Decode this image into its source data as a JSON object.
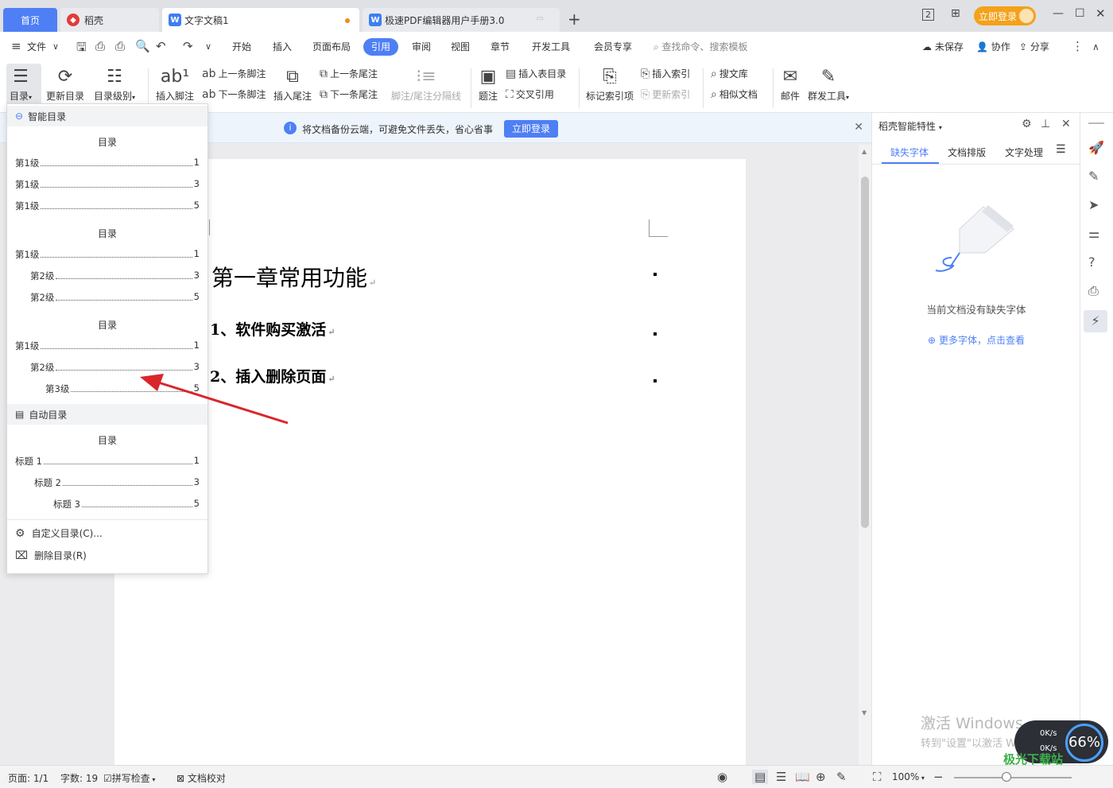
{
  "tabs": {
    "home": "首页",
    "daoke": "稻壳",
    "doc1": "文字文稿1",
    "pdf": "极速PDF编辑器用户手册3.0"
  },
  "top_right": {
    "login": "立即登录",
    "badge": "2"
  },
  "menubar": {
    "file": "文件",
    "items": [
      "开始",
      "插入",
      "页面布局",
      "引用",
      "审阅",
      "视图",
      "章节",
      "开发工具",
      "会员专享"
    ],
    "search": "查找命令、搜索模板",
    "unsaved": "未保存",
    "collab": "协作",
    "share": "分享"
  },
  "ribbon": {
    "mulu": "目录",
    "update_toc": "更新目录",
    "toc_level": "目录级别",
    "insert_footnote": "插入脚注",
    "prev_footnote": "上一条脚注",
    "next_footnote": "下一条脚注",
    "insert_endnote": "插入尾注",
    "prev_endnote": "上一条尾注",
    "next_endnote": "下一条尾注",
    "separator": "脚注/尾注分隔线",
    "caption": "题注",
    "insert_table_toc": "插入表目录",
    "cross_ref": "交叉引用",
    "mark_index": "标记索引项",
    "insert_index": "插入索引",
    "update_index": "更新索引",
    "search_lib": "搜文库",
    "similar_doc": "相似文档",
    "mail": "邮件",
    "mass_tools": "群发工具"
  },
  "notice": {
    "text": "将文档备份云端，可避免文件丢失，省心省事",
    "button": "立即登录"
  },
  "document": {
    "h1": "第一章常用功能",
    "h2a": "1、软件购买激活",
    "h2b": "2、插入删除页面"
  },
  "dropdown": {
    "smart_title": "智能目录",
    "toc_heading": "目录",
    "g1": [
      {
        "label": "第1级",
        "page": "1"
      },
      {
        "label": "第1级",
        "page": "3"
      },
      {
        "label": "第1级",
        "page": "5"
      }
    ],
    "g2": [
      {
        "label": "第1级",
        "page": "1"
      },
      {
        "label": "第2级",
        "page": "3"
      },
      {
        "label": "第2级",
        "page": "5"
      }
    ],
    "g3": [
      {
        "label": "第1级",
        "page": "1"
      },
      {
        "label": "第2级",
        "page": "3"
      },
      {
        "label": "第3级",
        "page": "5"
      }
    ],
    "auto_title": "自动目录",
    "g4": [
      {
        "label": "标题 1",
        "page": "1"
      },
      {
        "label": "标题 2",
        "page": "3"
      },
      {
        "label": "标题 3",
        "page": "5"
      }
    ],
    "custom": "自定义目录(C)...",
    "delete": "删除目录(R)"
  },
  "panel": {
    "title": "稻壳智能特性",
    "tabs": [
      "缺失字体",
      "文档排版",
      "文字处理"
    ],
    "no_missing": "当前文档没有缺失字体",
    "more": "更多字体，点击查看"
  },
  "watermark": {
    "line1": "激活 Windows",
    "line2": "转到\"设置\"以激活 Windows。"
  },
  "speed": {
    "up": "0K/s",
    "down": "0K/s",
    "pct": "66%"
  },
  "site": "极光下载站",
  "status": {
    "page": "页面: 1/1",
    "words": "字数: 19",
    "spell": "拼写检查",
    "proof": "文档校对",
    "zoom": "100%"
  },
  "colors": {
    "accent": "#4e7ff5",
    "login": "#f3a21a",
    "arrow": "#d9262b"
  }
}
